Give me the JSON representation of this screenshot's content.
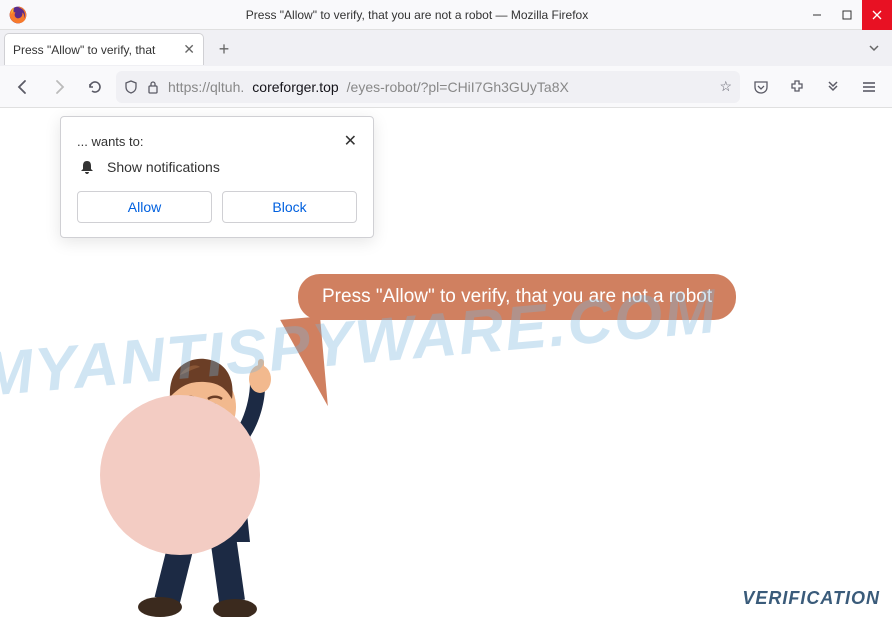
{
  "window": {
    "title": "Press \"Allow\" to verify, that you are not a robot — Mozilla Firefox"
  },
  "tab": {
    "label": "Press \"Allow\" to verify, that"
  },
  "url": {
    "protocol": "https://qltuh.",
    "domain": "coreforger.top",
    "path": "/eyes-robot/?pl=CHiI7Gh3GUyTa8X"
  },
  "permission": {
    "wants_to": "... wants to:",
    "capability": "Show notifications",
    "allow_label": "Allow",
    "block_label": "Block"
  },
  "bubble": {
    "text": "Press \"Allow\" to verify, that you are not a robot"
  },
  "footer": {
    "verification": "VERIFICATION"
  },
  "watermark": {
    "text": "MYANTISPYWARE.COM"
  }
}
